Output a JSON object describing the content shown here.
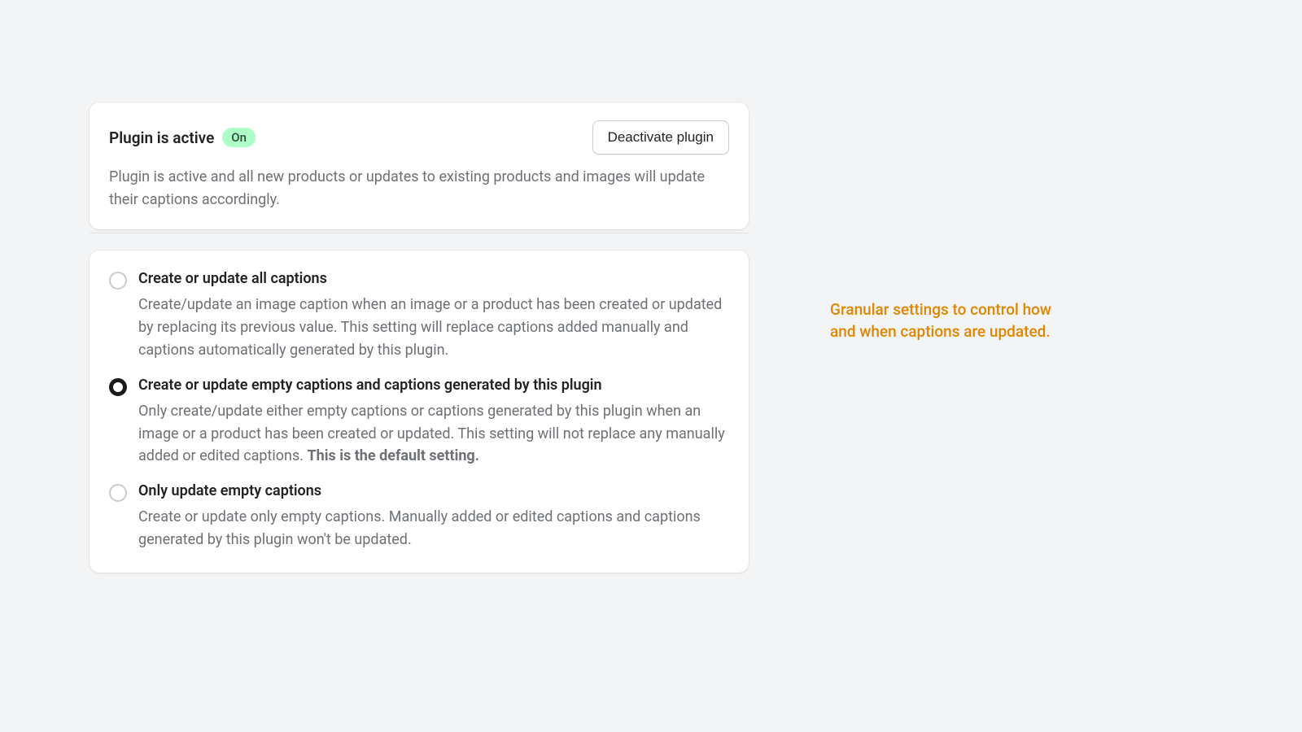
{
  "status": {
    "title": "Plugin is active",
    "badge": "On",
    "button": "Deactivate plugin",
    "description": "Plugin is active and all new products or updates to existing products and images will update their captions accordingly."
  },
  "options": [
    {
      "title": "Create or update all captions",
      "desc": "Create/update an image caption when an image or a product has been created or updated by replacing its previous value. This setting will replace captions added manually and captions automatically generated by this plugin.",
      "emphasis": "",
      "selected": false
    },
    {
      "title": "Create or update empty captions and captions generated by this plugin",
      "desc": "Only create/update either empty captions or captions generated by this plugin when an image or a product has been created or updated. This setting will not replace any manually added or edited captions. ",
      "emphasis": "This is the default setting.",
      "selected": true
    },
    {
      "title": "Only update empty captions",
      "desc": "Create or update only empty captions. Manually added or edited captions and captions generated by this plugin won't be updated.",
      "emphasis": "",
      "selected": false
    }
  ],
  "annotation": "Granular settings to control how and when captions are updated."
}
